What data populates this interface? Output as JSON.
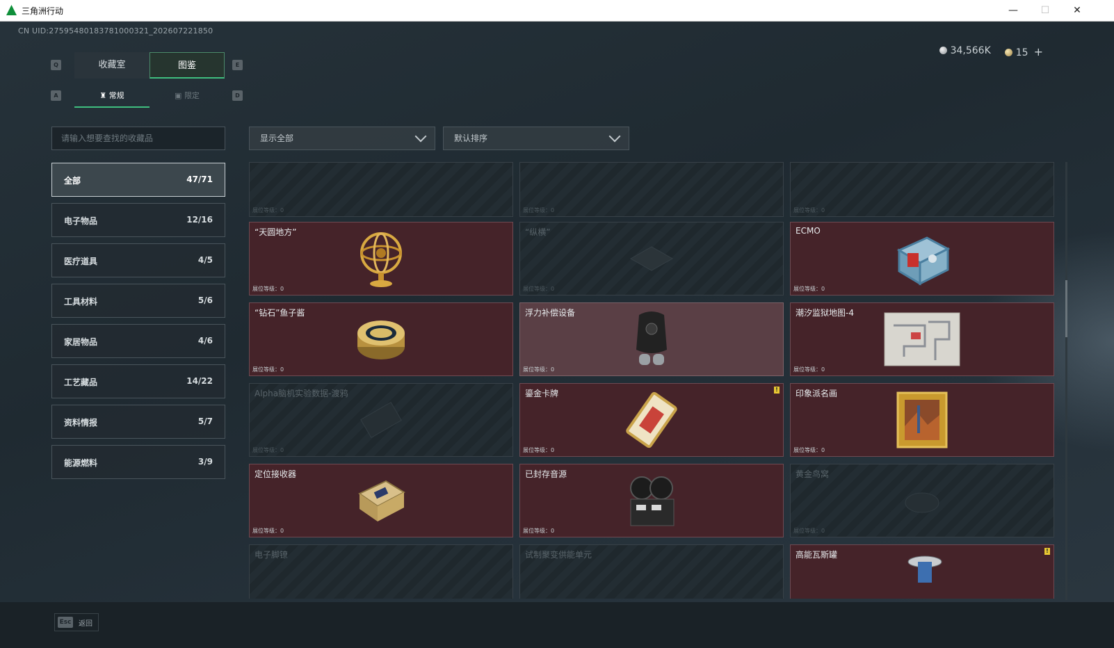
{
  "window": {
    "title": "三角洲行动",
    "minimize": "—",
    "maximize": "☐",
    "close": "✕"
  },
  "uid": "CN UID:2759548018378100032​1_202607221850",
  "currency": {
    "silver": "34,566K",
    "gold": "15",
    "plus": "+"
  },
  "keys": {
    "q": "Q",
    "e": "E",
    "a": "A",
    "d": "D"
  },
  "tabs": [
    {
      "label": "收藏室"
    },
    {
      "label": "图鉴"
    }
  ],
  "subtabs": [
    {
      "label": "常规"
    },
    {
      "label": "限定"
    }
  ],
  "search": {
    "placeholder": "请输入想要查找的收藏品"
  },
  "filter": {
    "value": "显示全部"
  },
  "sort": {
    "value": "默认排序"
  },
  "categories": [
    {
      "name": "全部",
      "count": "47/71"
    },
    {
      "name": "电子物品",
      "count": "12/16"
    },
    {
      "name": "医疗道具",
      "count": "4/5"
    },
    {
      "name": "工具材料",
      "count": "5/6"
    },
    {
      "name": "家居物品",
      "count": "4/6"
    },
    {
      "name": "工艺藏品",
      "count": "14/22"
    },
    {
      "name": "资料情报",
      "count": "5/7"
    },
    {
      "name": "能源燃料",
      "count": "3/9"
    }
  ],
  "cards": [
    {
      "name": "",
      "level": "展位等级：0",
      "state": "locked",
      "icon": "unknown-item-icon"
    },
    {
      "name": "",
      "level": "展位等级：0",
      "state": "locked",
      "icon": "unknown-item-icon"
    },
    {
      "name": "",
      "level": "展位等级：0",
      "state": "locked",
      "icon": "unknown-item-icon"
    },
    {
      "name": "“天圆地方”",
      "level": "展位等级：0",
      "state": "owned",
      "icon": "armillary-sphere-icon"
    },
    {
      "name": "“纵横”",
      "level": "展位等级：0",
      "state": "locked",
      "icon": "chessboard-icon"
    },
    {
      "name": "ECMO",
      "level": "展位等级：0",
      "state": "owned",
      "icon": "ecmo-machine-icon"
    },
    {
      "name": "“钻石”鱼子酱",
      "level": "展位等级：0",
      "state": "owned",
      "icon": "caviar-tin-icon"
    },
    {
      "name": "浮力补偿设备",
      "level": "展位等级：0",
      "state": "selected",
      "icon": "bcd-gear-icon"
    },
    {
      "name": "潮汐监狱地图-4",
      "level": "展位等级：0",
      "state": "owned",
      "icon": "map-sheet-icon"
    },
    {
      "name": "Alpha脑机实验数据-渡鸦",
      "level": "展位等级：0",
      "state": "locked",
      "icon": "data-drive-icon"
    },
    {
      "name": "鎏金卡牌",
      "level": "展位等级：0",
      "state": "owned",
      "icon": "gilded-card-icon",
      "badge": "!"
    },
    {
      "name": "印象派名画",
      "level": "展位等级：0",
      "state": "owned",
      "icon": "painting-icon"
    },
    {
      "name": "定位接收器",
      "level": "展位等级：0",
      "state": "owned",
      "icon": "gps-receiver-icon"
    },
    {
      "name": "已封存音源",
      "level": "展位等级：0",
      "state": "owned",
      "icon": "reel-recorder-icon"
    },
    {
      "name": "黄金鸟窝",
      "level": "展位等级：0",
      "state": "locked",
      "icon": "golden-nest-icon"
    },
    {
      "name": "电子脚镣",
      "level": "",
      "state": "locked",
      "icon": "ankle-monitor-icon"
    },
    {
      "name": "试制聚变供能单元",
      "level": "",
      "state": "locked",
      "icon": "fusion-cell-icon"
    },
    {
      "name": "高能瓦斯罐",
      "level": "",
      "state": "owned",
      "icon": "gas-canister-icon",
      "badge": "!"
    }
  ],
  "footer": {
    "esc_key": "Esc",
    "back_label": "返回"
  },
  "colors": {
    "accent": "#3fbf7f",
    "owned": "#452329",
    "selected": "#5a3f45",
    "badge": "#e8c832"
  }
}
